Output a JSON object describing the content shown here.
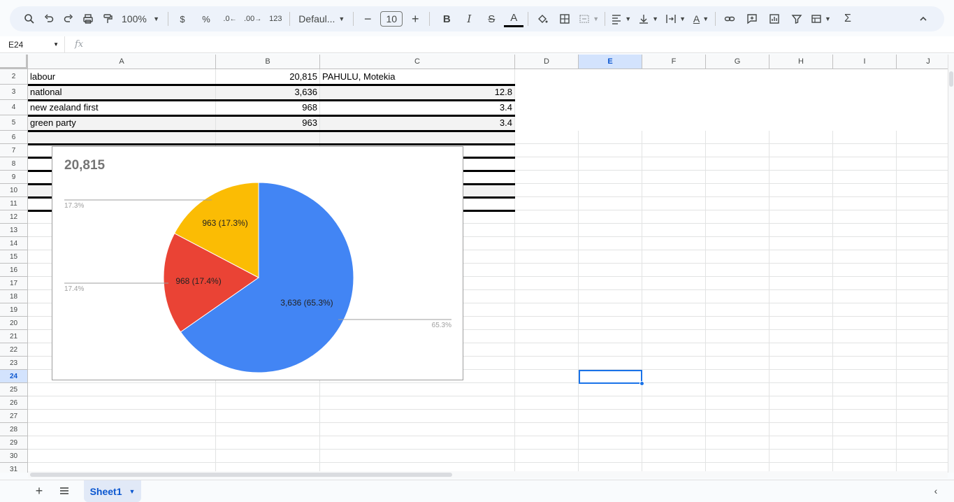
{
  "toolbar": {
    "zoom": "100%",
    "font": "Defaul...",
    "font_size": "10",
    "currency": "$",
    "percent": "%",
    "dec_decrease": ".0",
    "dec_increase": ".00",
    "number_format": "123"
  },
  "formula_bar": {
    "name_box": "E24",
    "fx": "fx",
    "content": ""
  },
  "columns": [
    "A",
    "B",
    "C",
    "D",
    "E",
    "F",
    "G",
    "H",
    "I",
    "J"
  ],
  "selected_column": "E",
  "rows": [
    "2",
    "3",
    "4",
    "5",
    "6",
    "7",
    "8",
    "9",
    "10",
    "11",
    "12",
    "13",
    "14",
    "15",
    "16",
    "17",
    "18",
    "19",
    "20",
    "21",
    "22",
    "23",
    "24",
    "25",
    "26",
    "27",
    "28",
    "29",
    "30",
    "31"
  ],
  "selected_row": "24",
  "cells": {
    "r2": {
      "a": "labour",
      "b": "20,815",
      "c": "PAHULU, Motekia"
    },
    "r3": {
      "a": "natlonal",
      "b": "3,636",
      "c": "12.8"
    },
    "r4": {
      "a": "new zealand first",
      "b": "968",
      "c": "3.4"
    },
    "r5": {
      "a": "green party",
      "b": "963",
      "c": "3.4"
    }
  },
  "chart_data": {
    "type": "pie",
    "title": "20,815",
    "slices": [
      {
        "label": "3,636 (65.3%)",
        "value": 3636,
        "percent": 65.3,
        "color": "#4285f4",
        "outside_label": "65.3%"
      },
      {
        "label": "968 (17.4%)",
        "value": 968,
        "percent": 17.4,
        "color": "#ea4335",
        "outside_label": "17.4%"
      },
      {
        "label": "963 (17.3%)",
        "value": 963,
        "percent": 17.3,
        "color": "#fbbc04",
        "outside_label": "17.3%"
      }
    ]
  },
  "sheets": [
    {
      "name": "Sheet1",
      "active": true
    }
  ],
  "icons": {
    "search": "search-icon",
    "undo": "undo-icon",
    "redo": "redo-icon",
    "print": "print-icon",
    "paint_format": "paint-format-icon",
    "bold": "B",
    "italic": "I",
    "strikethrough": "S",
    "text_color": "A",
    "fill": "fill-color-icon",
    "borders": "borders-icon",
    "merge": "merge-icon",
    "align": "align-icon",
    "valign": "vertical-align-icon",
    "wrap": "wrap-icon",
    "rotate": "rotate-icon",
    "link": "link-icon",
    "comment": "comment-icon",
    "chart": "chart-icon",
    "filter": "filter-icon",
    "views": "filter-views-icon",
    "functions": "Σ",
    "collapse": "chevron-up-icon"
  },
  "colors": {
    "accent": "#1a73e8",
    "selected_header": "#d3e3fd",
    "toolbar_bg": "#edf2fa"
  }
}
